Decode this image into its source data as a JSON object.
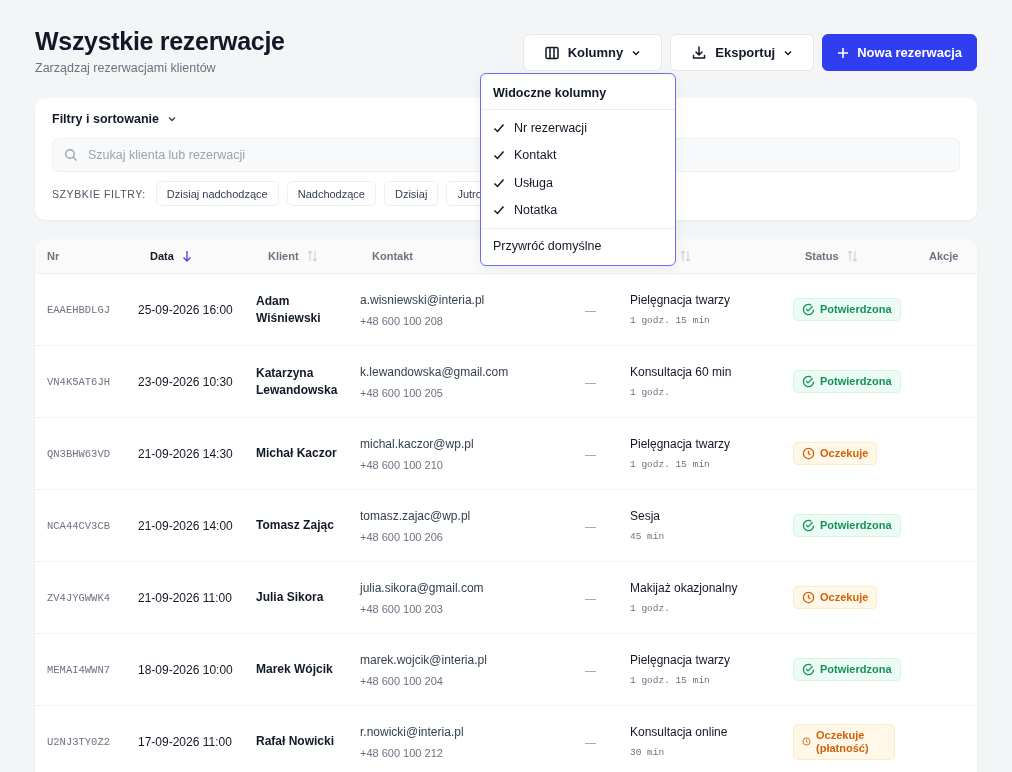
{
  "header": {
    "title": "Wszystkie rezerwacje",
    "subtitle": "Zarządzaj rezerwacjami klientów"
  },
  "actions": [
    {
      "kind": "columns",
      "label": "Kolumny"
    },
    {
      "kind": "export",
      "label": "Eksportuj"
    },
    {
      "kind": "new",
      "label": "Nowa rezerwacja"
    }
  ],
  "columns_menu": {
    "title": "Widoczne kolumny",
    "items": [
      {
        "label": "Nr rezerwacji",
        "checked": true
      },
      {
        "label": "Kontakt",
        "checked": true
      },
      {
        "label": "Usługa",
        "checked": true
      },
      {
        "label": "Notatka",
        "checked": true
      }
    ],
    "reset": "Przywróć domyślne"
  },
  "filters": {
    "title": "Filtry i sortowanie",
    "search": {
      "placeholder": "Szukaj klienta lub rezerwacji"
    },
    "quick_label": "SZYBKIE FILTRY:",
    "quick": [
      "Dzisiaj nadchodzące",
      "Nadchodzące",
      "Dzisiaj",
      "Jutro"
    ]
  },
  "table": {
    "columns": [
      {
        "label": "Nr",
        "sortable": false,
        "sorted": false
      },
      {
        "label": "Data",
        "sortable": true,
        "sorted": true
      },
      {
        "label": "Klient",
        "sortable": true,
        "sorted": false
      },
      {
        "label": "Kontakt",
        "sortable": false,
        "sorted": false
      },
      {},
      {
        "sortable": true,
        "sorted": false
      },
      {
        "label": "Status",
        "sortable": true,
        "sorted": false
      },
      {
        "label": "Akcje",
        "sortable": false,
        "sorted": false
      }
    ],
    "rows": [
      {
        "nr": "EAAEHBDLGJ",
        "date": "25-09-2026 16:00",
        "client": "Adam Wiśniewski",
        "email": "a.wisniewski@interia.pl",
        "phone": "+48 600 100 208",
        "note": "—",
        "service": "Pielęgnacja twarzy",
        "duration": "1 godz. 15 min",
        "status": {
          "kind": "confirmed",
          "label": "Potwierdzona"
        }
      },
      {
        "nr": "VN4K5AT6JH",
        "date": "23-09-2026 10:30",
        "client": "Katarzyna Lewandowska",
        "email": "k.lewandowska@gmail.com",
        "phone": "+48 600 100 205",
        "note": "—",
        "service": "Konsultacja 60 min",
        "duration": "1 godz.",
        "status": {
          "kind": "confirmed",
          "label": "Potwierdzona"
        }
      },
      {
        "nr": "QN3BHW63VD",
        "date": "21-09-2026 14:30",
        "client": "Michał Kaczor",
        "email": "michal.kaczor@wp.pl",
        "phone": "+48 600 100 210",
        "note": "—",
        "service": "Pielęgnacja twarzy",
        "duration": "1 godz. 15 min",
        "status": {
          "kind": "pending",
          "label": "Oczekuje"
        }
      },
      {
        "nr": "NCA44CV3CB",
        "date": "21-09-2026 14:00",
        "client": "Tomasz Zając",
        "email": "tomasz.zajac@wp.pl",
        "phone": "+48 600 100 206",
        "note": "—",
        "service": "Sesja",
        "duration": "45 min",
        "status": {
          "kind": "confirmed",
          "label": "Potwierdzona"
        }
      },
      {
        "nr": "ZV4JYGWWK4",
        "date": "21-09-2026 11:00",
        "client": "Julia Sikora",
        "email": "julia.sikora@gmail.com",
        "phone": "+48 600 100 203",
        "note": "—",
        "service": "Makijaż okazjonalny",
        "duration": "1 godz.",
        "status": {
          "kind": "pending",
          "label": "Oczekuje"
        }
      },
      {
        "nr": "MEMAI4WWN7",
        "date": "18-09-2026 10:00",
        "client": "Marek Wójcik",
        "email": "marek.wojcik@interia.pl",
        "phone": "+48 600 100 204",
        "note": "—",
        "service": "Pielęgnacja twarzy",
        "duration": "1 godz. 15 min",
        "status": {
          "kind": "confirmed",
          "label": "Potwierdzona"
        }
      },
      {
        "nr": "U2NJ3TY0Z2",
        "date": "17-09-2026 11:00",
        "client": "Rafał Nowicki",
        "email": "r.nowicki@interia.pl",
        "phone": "+48 600 100 212",
        "note": "—",
        "service": "Konsultacja online",
        "duration": "30 min",
        "status": {
          "kind": "pending_payment",
          "label": "Oczekuje (płatność)"
        }
      }
    ]
  }
}
